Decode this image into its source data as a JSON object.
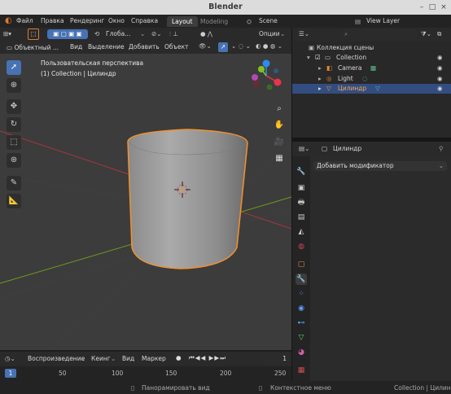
{
  "window": {
    "title": "Blender"
  },
  "menu": {
    "items": [
      "Файл",
      "Правка",
      "Рендеринг",
      "Окно",
      "Справка"
    ],
    "workspace_tabs": [
      "Layout",
      "Modeling"
    ],
    "scene": "Scene",
    "view_layer": "View Layer"
  },
  "vp_header": {
    "orientation": "Глоба...",
    "options": "Опции"
  },
  "vp_header2": {
    "mode": "Объектный ...",
    "menus": [
      "Вид",
      "Выделение",
      "Добавить",
      "Объект"
    ]
  },
  "viewport": {
    "view_name": "Пользовательская перспектива",
    "collection_info": "(1) Collection | Цилиндр",
    "axes": [
      "Z",
      "Y",
      "X"
    ]
  },
  "outliner": {
    "root": "Коллекция сцены",
    "collection": "Collection",
    "objects": [
      "Camera",
      "Light",
      "Цилиндр"
    ]
  },
  "properties": {
    "object_name": "Цилиндр",
    "add_modifier": "Добавить модификатор"
  },
  "timeline": {
    "menus": [
      "Воспроизведение",
      "Кеинг",
      "Вид",
      "Маркер"
    ],
    "current_frame": "1",
    "ticks": [
      "1",
      "50",
      "100",
      "150",
      "200",
      "250"
    ]
  },
  "status": {
    "pan": "Панорамировать вид",
    "context": "Контекстное меню",
    "info": "Collection | Цилиндр"
  },
  "colors": {
    "accent": "#4772b3",
    "selection_outline": "#f2922e",
    "axis_x": "#e8344a",
    "axis_y": "#82c21f",
    "axis_z": "#2d8cf0"
  }
}
